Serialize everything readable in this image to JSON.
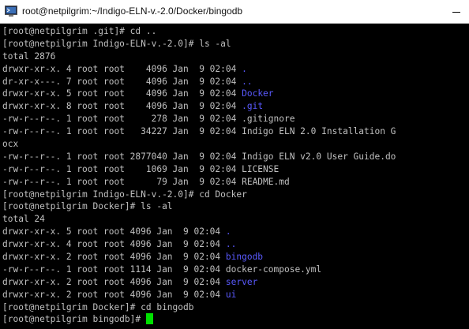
{
  "window": {
    "title": "root@netpilgrim:~/Indigo-ELN-v.-2.0/Docker/bingodb"
  },
  "colors": {
    "background": "#000000",
    "text": "#c0c0c0",
    "directory": "#5a5aff",
    "cursor": "#00e000"
  },
  "terminal": {
    "lines": [
      {
        "segments": [
          {
            "text": "[root@netpilgrim .git]# cd .."
          }
        ]
      },
      {
        "segments": [
          {
            "text": "[root@netpilgrim Indigo-ELN-v.-2.0]# ls -al"
          }
        ]
      },
      {
        "segments": [
          {
            "text": "total 2876"
          }
        ]
      },
      {
        "segments": [
          {
            "text": "drwxr-xr-x. 4 root root    4096 Jan  9 02:04 "
          },
          {
            "text": ".",
            "kind": "dir"
          }
        ]
      },
      {
        "segments": [
          {
            "text": "dr-xr-x---. 7 root root    4096 Jan  9 02:04 "
          },
          {
            "text": "..",
            "kind": "dir"
          }
        ]
      },
      {
        "segments": [
          {
            "text": "drwxr-xr-x. 5 root root    4096 Jan  9 02:04 "
          },
          {
            "text": "Docker",
            "kind": "dir"
          }
        ]
      },
      {
        "segments": [
          {
            "text": "drwxr-xr-x. 8 root root    4096 Jan  9 02:04 "
          },
          {
            "text": ".git",
            "kind": "dir"
          }
        ]
      },
      {
        "segments": [
          {
            "text": "-rw-r--r--. 1 root root     278 Jan  9 02:04 .gitignore"
          }
        ]
      },
      {
        "segments": [
          {
            "text": "-rw-r--r--. 1 root root   34227 Jan  9 02:04 Indigo ELN 2.0 Installation G"
          }
        ]
      },
      {
        "segments": [
          {
            "text": "ocx"
          }
        ]
      },
      {
        "segments": [
          {
            "text": "-rw-r--r--. 1 root root 2877040 Jan  9 02:04 Indigo ELN v2.0 User Guide.do"
          }
        ]
      },
      {
        "segments": [
          {
            "text": "-rw-r--r--. 1 root root    1069 Jan  9 02:04 LICENSE"
          }
        ]
      },
      {
        "segments": [
          {
            "text": "-rw-r--r--. 1 root root      79 Jan  9 02:04 README.md"
          }
        ]
      },
      {
        "segments": [
          {
            "text": "[root@netpilgrim Indigo-ELN-v.-2.0]# cd Docker"
          }
        ]
      },
      {
        "segments": [
          {
            "text": "[root@netpilgrim Docker]# ls -al"
          }
        ]
      },
      {
        "segments": [
          {
            "text": "total 24"
          }
        ]
      },
      {
        "segments": [
          {
            "text": "drwxr-xr-x. 5 root root 4096 Jan  9 02:04 "
          },
          {
            "text": ".",
            "kind": "dir"
          }
        ]
      },
      {
        "segments": [
          {
            "text": "drwxr-xr-x. 4 root root 4096 Jan  9 02:04 "
          },
          {
            "text": "..",
            "kind": "dir"
          }
        ]
      },
      {
        "segments": [
          {
            "text": "drwxr-xr-x. 2 root root 4096 Jan  9 02:04 "
          },
          {
            "text": "bingodb",
            "kind": "dir"
          }
        ]
      },
      {
        "segments": [
          {
            "text": "-rw-r--r--. 1 root root 1114 Jan  9 02:04 docker-compose.yml"
          }
        ]
      },
      {
        "segments": [
          {
            "text": "drwxr-xr-x. 2 root root 4096 Jan  9 02:04 "
          },
          {
            "text": "server",
            "kind": "dir"
          }
        ]
      },
      {
        "segments": [
          {
            "text": "drwxr-xr-x. 2 root root 4096 Jan  9 02:04 "
          },
          {
            "text": "ui",
            "kind": "dir"
          }
        ]
      },
      {
        "segments": [
          {
            "text": "[root@netpilgrim Docker]# cd bingodb"
          }
        ]
      },
      {
        "segments": [
          {
            "text": "[root@netpilgrim bingodb]# "
          }
        ],
        "cursor": true
      }
    ]
  }
}
